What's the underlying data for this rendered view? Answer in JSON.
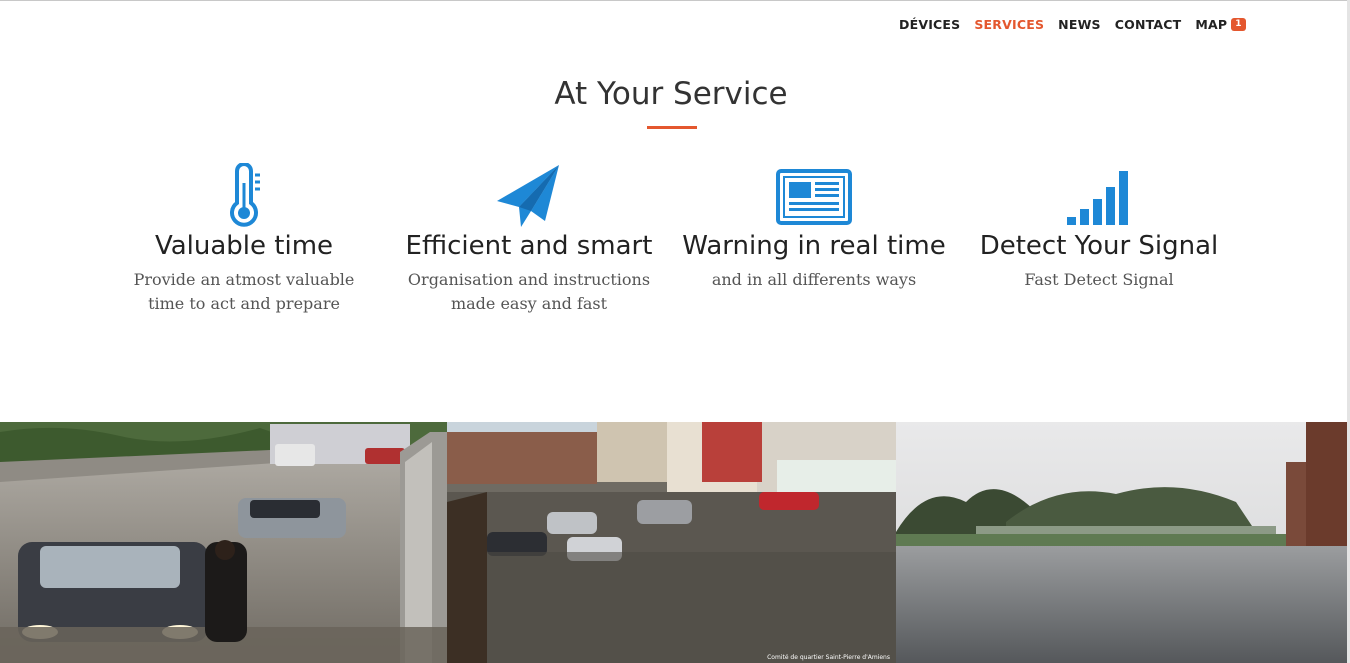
{
  "nav": {
    "items": [
      {
        "label": "DÉVICES",
        "active": false
      },
      {
        "label": "SERVICES",
        "active": true
      },
      {
        "label": "NEWS",
        "active": false
      },
      {
        "label": "CONTACT",
        "active": false
      },
      {
        "label": "MAP",
        "active": false
      }
    ],
    "map_badge": "1",
    "accent_color": "#e4572e"
  },
  "section": {
    "title": "At Your Service",
    "icon_color": "#1e88d6"
  },
  "services": [
    {
      "icon": "thermometer-icon",
      "title": "Valuable time",
      "description": "Provide an atmost valuable time to act and prepare"
    },
    {
      "icon": "paper-plane-icon",
      "title": "Efficient and smart",
      "description": "Organisation and instructions made easy and fast"
    },
    {
      "icon": "newspaper-icon",
      "title": "Warning in real time",
      "description": "and in all differents ways"
    },
    {
      "icon": "signal-bars-icon",
      "title": "Detect Your Signal",
      "description": "Fast Detect Signal"
    }
  ],
  "gallery": {
    "photo2_caption": "Comité de quartier Saint-Pierre d'Amiens"
  }
}
